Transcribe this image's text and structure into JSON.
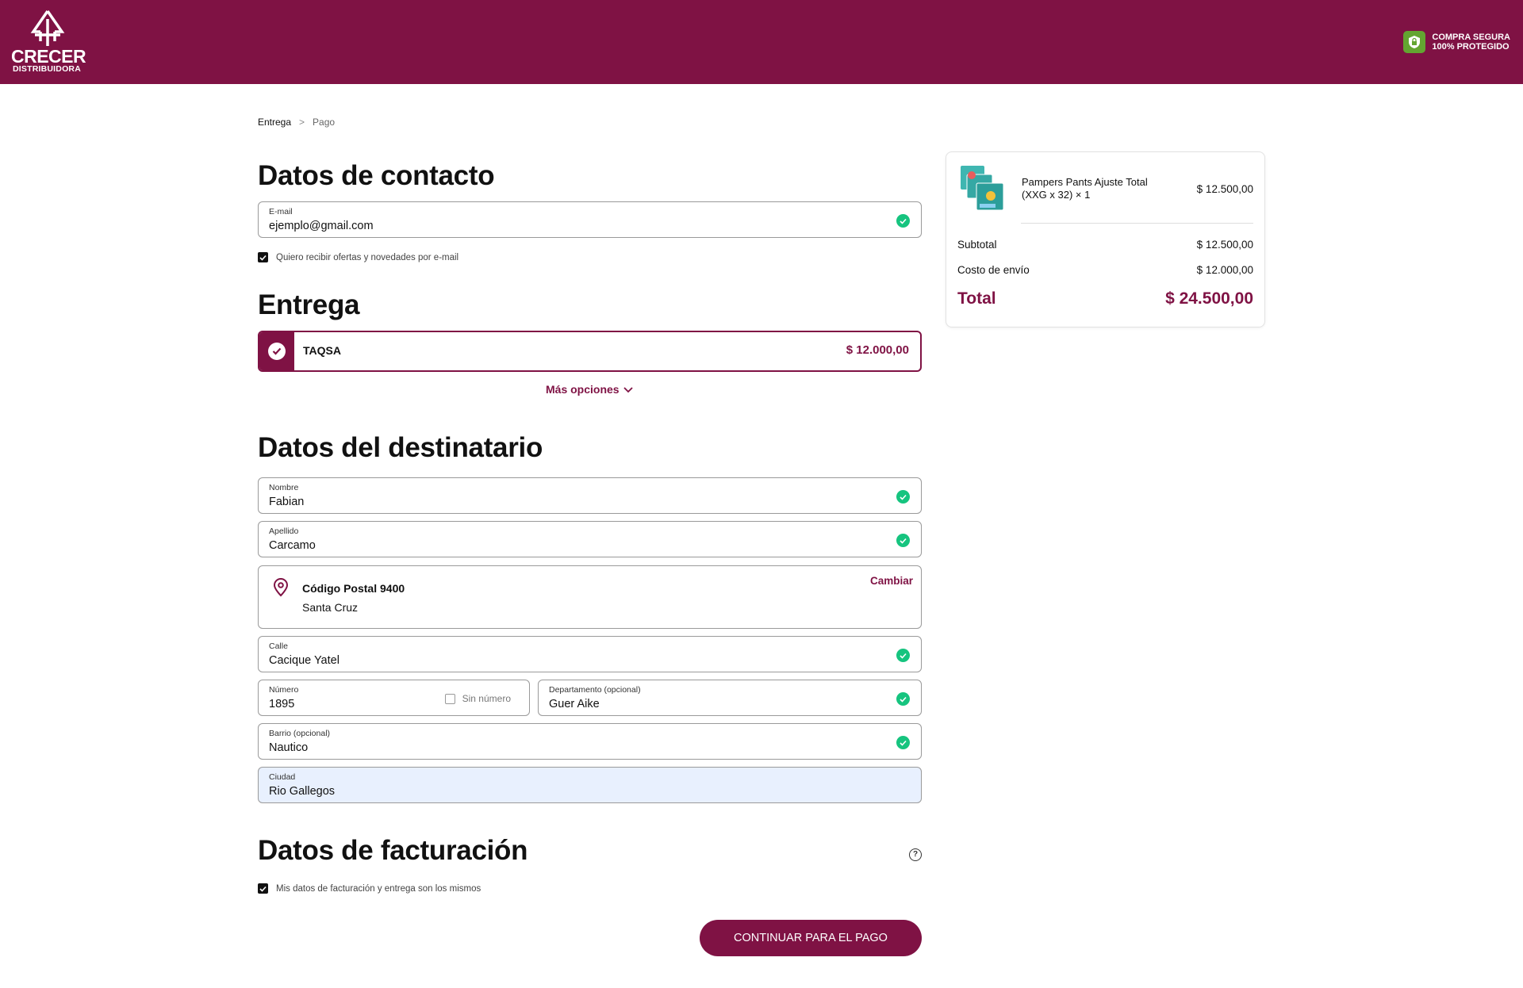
{
  "header": {
    "brand": "CRECER",
    "brand_sub": "DISTRIBUIDORA",
    "secure_line1": "COMPRA SEGURA",
    "secure_line2": "100% PROTEGIDO",
    "bg_color": "#7f1244"
  },
  "breadcrumb": {
    "current": "Entrega",
    "separator": ">",
    "next": "Pago"
  },
  "contact": {
    "title": "Datos de contacto",
    "email_label": "E-mail",
    "email_value": "ejemplo@gmail.com",
    "newsletter_label": "Quiero recibir ofertas y novedades por e-mail"
  },
  "delivery": {
    "title": "Entrega",
    "option_name": "TAQSA",
    "option_price": "$ 12.000,00",
    "more_options": "Más opciones"
  },
  "recipient": {
    "title": "Datos del destinatario",
    "nombre_label": "Nombre",
    "nombre_value": "Fabian",
    "apellido_label": "Apellido",
    "apellido_value": "Carcamo",
    "postal": "Código Postal 9400",
    "province": "Santa Cruz",
    "change": "Cambiar",
    "calle_label": "Calle",
    "calle_value": "Cacique Yatel",
    "numero_label": "Número",
    "numero_value": "1895",
    "sin_numero": "Sin número",
    "depto_label": "Departamento (opcional)",
    "depto_value": "Guer Aike",
    "barrio_label": "Barrio (opcional)",
    "barrio_value": "Nautico",
    "ciudad_label": "Ciudad",
    "ciudad_value": "Rio Gallegos"
  },
  "billing": {
    "title": "Datos de facturación",
    "same_label": "Mis datos de facturación y entrega son los mismos",
    "help": "?"
  },
  "cta": {
    "label": "CONTINUAR PARA EL PAGO"
  },
  "summary": {
    "product_name": "Pampers Pants Ajuste Total (XXG x 32) × 1",
    "product_price": "$ 12.500,00",
    "subtotal_label": "Subtotal",
    "subtotal_value": "$ 12.500,00",
    "shipping_label": "Costo de envío",
    "shipping_value": "$ 12.000,00",
    "total_label": "Total",
    "total_value": "$ 24.500,00"
  }
}
